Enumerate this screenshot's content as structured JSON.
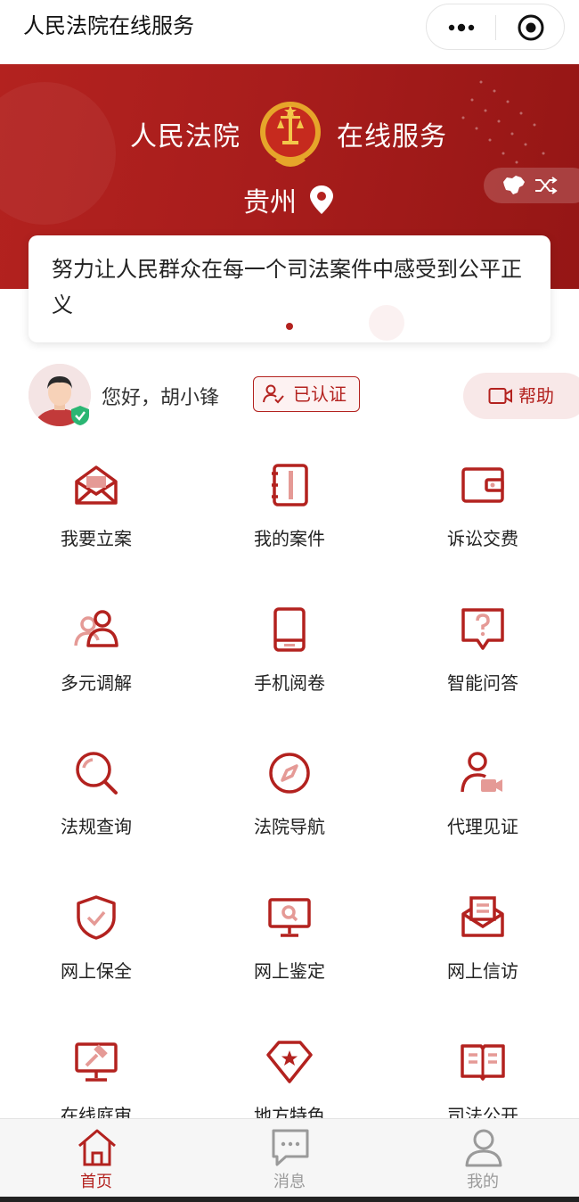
{
  "navbar": {
    "title": "人民法院在线服务",
    "more_icon": "more-dots-icon",
    "close_icon": "close-target-icon"
  },
  "banner": {
    "title_left": "人民法院",
    "title_right": "在线服务",
    "city": "贵州",
    "emblem_icon": "national-emblem-icon",
    "location_icon": "location-pin-icon",
    "map_icon": "china-map-icon",
    "switch_icon": "shuffle-icon"
  },
  "slogan": {
    "text": "努力让人民群众在每一个司法案件中感受到公平正义"
  },
  "user": {
    "greeting": "您好，胡小锋",
    "verified_label": "已认证",
    "help_label": "帮助"
  },
  "services": [
    {
      "label": "我要立案",
      "icon": "envelope-icon"
    },
    {
      "label": "我的案件",
      "icon": "notebook-icon"
    },
    {
      "label": "诉讼交费",
      "icon": "wallet-icon"
    },
    {
      "label": "多元调解",
      "icon": "people-icon"
    },
    {
      "label": "手机阅卷",
      "icon": "mobile-icon"
    },
    {
      "label": "智能问答",
      "icon": "question-bubble-icon"
    },
    {
      "label": "法规查询",
      "icon": "search-icon"
    },
    {
      "label": "法院导航",
      "icon": "compass-icon"
    },
    {
      "label": "代理见证",
      "icon": "user-video-icon"
    },
    {
      "label": "网上保全",
      "icon": "shield-check-icon"
    },
    {
      "label": "网上鉴定",
      "icon": "monitor-search-icon"
    },
    {
      "label": "网上信访",
      "icon": "letter-icon"
    },
    {
      "label": "在线庭审",
      "icon": "gavel-monitor-icon"
    },
    {
      "label": "地方特色",
      "icon": "star-badge-icon"
    },
    {
      "label": "司法公开",
      "icon": "open-book-icon"
    }
  ],
  "tabbar": {
    "items": [
      {
        "label": "首页",
        "icon": "home-icon",
        "active": true
      },
      {
        "label": "消息",
        "icon": "message-icon",
        "active": false
      },
      {
        "label": "我的",
        "icon": "user-icon",
        "active": false
      }
    ]
  },
  "colors": {
    "accent": "#b3221f",
    "tab_inactive": "#9a9a9a"
  }
}
